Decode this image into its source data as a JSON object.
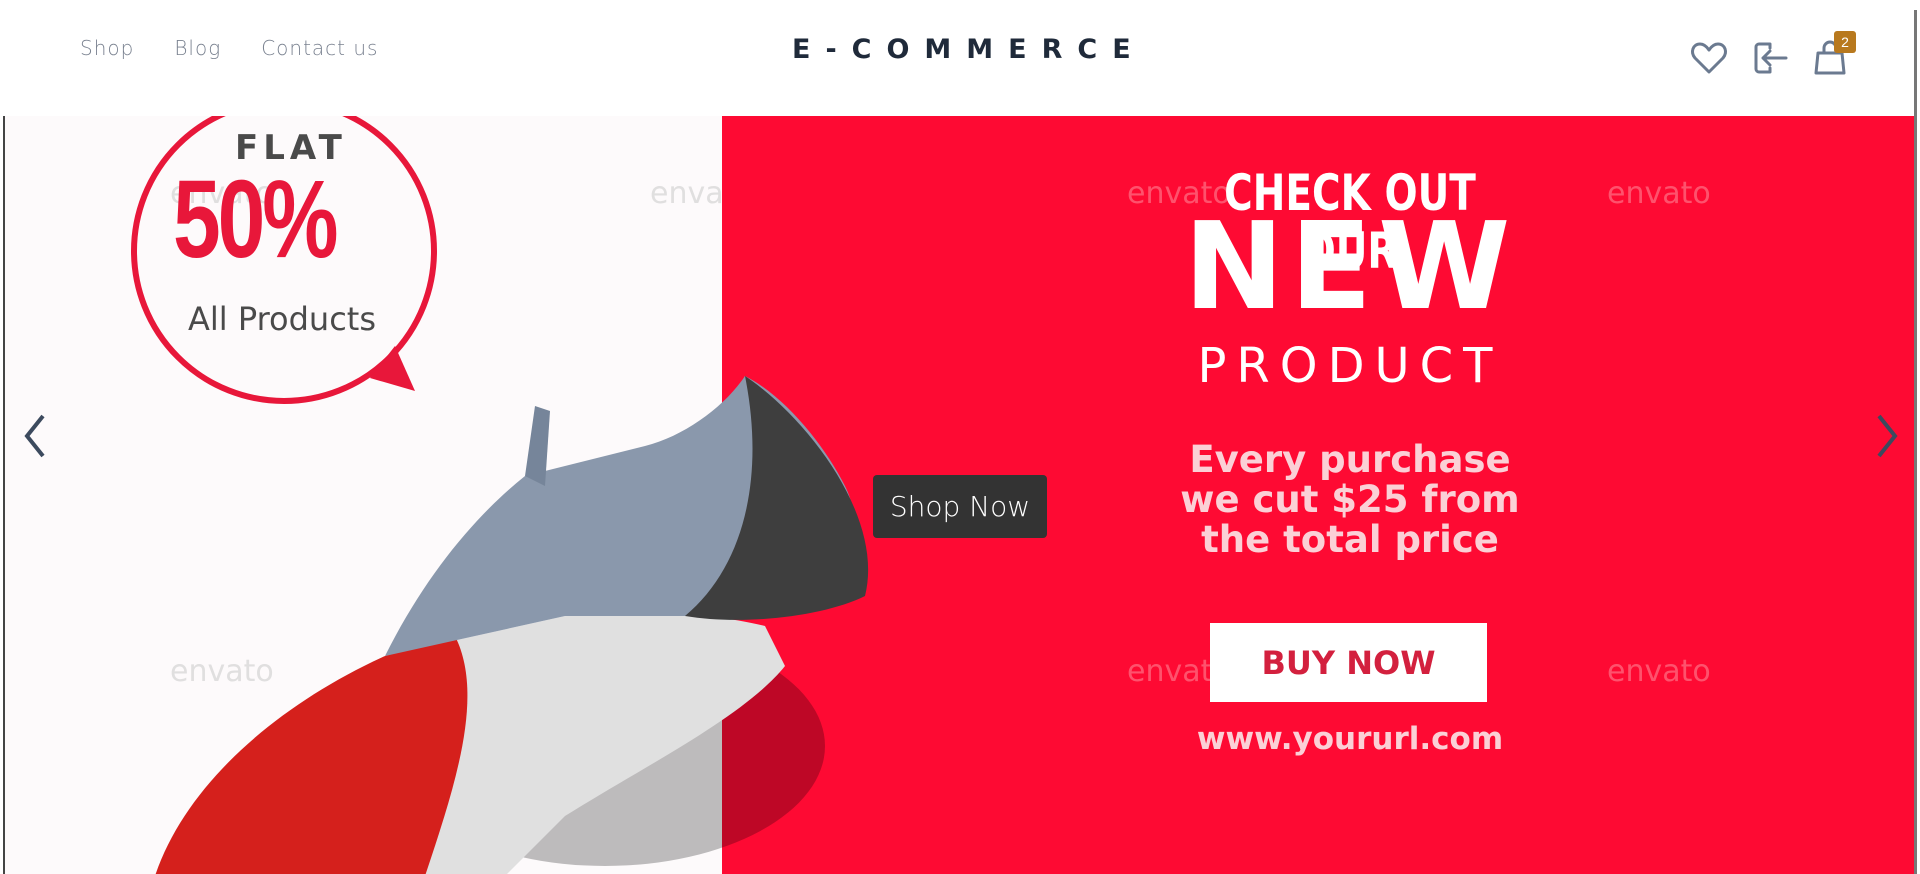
{
  "header": {
    "nav": [
      "Shop",
      "Blog",
      "Contact us"
    ],
    "logo": "E-COMMERCE",
    "cart_count": "2"
  },
  "banner": {
    "flat": "FLAT",
    "percent": "50%",
    "all_products": "All Products",
    "headline1": "CHECK OUT OUR",
    "headline2": "NEW",
    "headline3": "PRODUCT",
    "offer": [
      "Every purchase",
      "we cut $25 from",
      "the total price"
    ],
    "buy_now": "BUY NOW",
    "url": "www.yoururl.com",
    "watermark": "envato",
    "shop_now": "Shop Now"
  },
  "colors": {
    "brand_red": "#fe0a33",
    "badge": "#b8791e",
    "icon": "#6b7a90"
  }
}
